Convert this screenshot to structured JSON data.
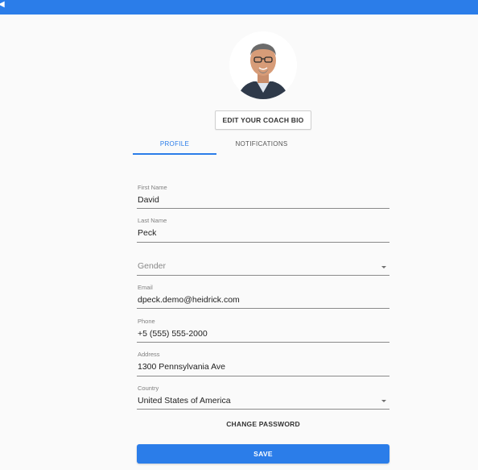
{
  "header": {
    "color": "#2b7de9",
    "back_icon": "back-icon",
    "back_glyph": "◀"
  },
  "profile": {
    "avatar_icon": "user-avatar-photo",
    "edit_bio_label": "EDIT YOUR COACH BIO"
  },
  "tabs": [
    {
      "label": "PROFILE",
      "active": true
    },
    {
      "label": "NOTIFICATIONS",
      "active": false
    }
  ],
  "form": {
    "first_name": {
      "label": "First Name",
      "value": "David"
    },
    "last_name": {
      "label": "Last Name",
      "value": "Peck"
    },
    "gender": {
      "placeholder": "Gender",
      "value": ""
    },
    "email": {
      "label": "Email",
      "value": "dpeck.demo@heidrick.com"
    },
    "phone": {
      "label": "Phone",
      "value": "+5 (555) 555-2000"
    },
    "address": {
      "label": "Address",
      "value": "1300 Pennsylvania Ave"
    },
    "country": {
      "label": "Country",
      "value": "United States of America"
    }
  },
  "actions": {
    "change_password_label": "CHANGE PASSWORD",
    "save_label": "SAVE"
  },
  "colors": {
    "accent": "#2b7de9",
    "background": "#fafafa"
  }
}
